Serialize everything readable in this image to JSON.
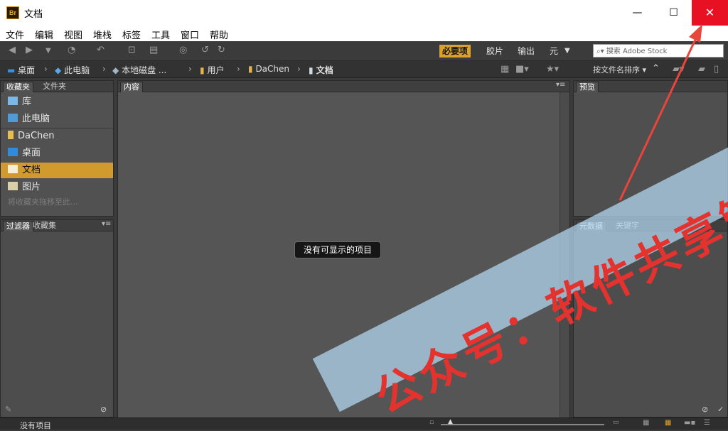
{
  "window": {
    "app_icon": "Br",
    "title": "文档",
    "min_glyph": "—",
    "max_glyph": "☐",
    "close_glyph": "✕"
  },
  "menu": [
    "文件",
    "编辑",
    "视图",
    "堆栈",
    "标签",
    "工具",
    "窗口",
    "帮助"
  ],
  "workspaces": {
    "essentials": "必要项",
    "filmstrip": "胶片",
    "output": "输出",
    "metadata": "元",
    "search_placeholder": "搜索 Adobe Stock"
  },
  "path": {
    "items": [
      "桌面",
      "此电脑",
      "本地磁盘 ...",
      "用户",
      "DaChen",
      "文档"
    ],
    "sort_label": "按文件名排序"
  },
  "left_panel": {
    "tabs": [
      "收藏夹",
      "文件夹"
    ],
    "favorites": [
      {
        "label": "库",
        "icon": "library-icon"
      },
      {
        "label": "此电脑",
        "icon": "computer-icon"
      },
      {
        "label": "DaChen",
        "icon": "folder-icon"
      },
      {
        "label": "桌面",
        "icon": "desktop-icon"
      },
      {
        "label": "文档",
        "icon": "document-folder-icon"
      },
      {
        "label": "图片",
        "icon": "pictures-icon"
      }
    ],
    "hint": "将收藏夹拖移至此...",
    "filter_tabs": [
      "过滤器",
      "收藏集"
    ]
  },
  "content": {
    "tab": "内容",
    "empty_message": "没有可显示的项目"
  },
  "right_panel": {
    "preview_tab": "预览",
    "metadata_tabs": [
      "元数据",
      "关键字"
    ]
  },
  "status": {
    "text": "没有项目"
  },
  "watermark": {
    "text": "公众号：软件共享管家"
  },
  "colors": {
    "accent": "#d9a22c",
    "close": "#e81123",
    "annotation_arrow": "#e8453c"
  }
}
